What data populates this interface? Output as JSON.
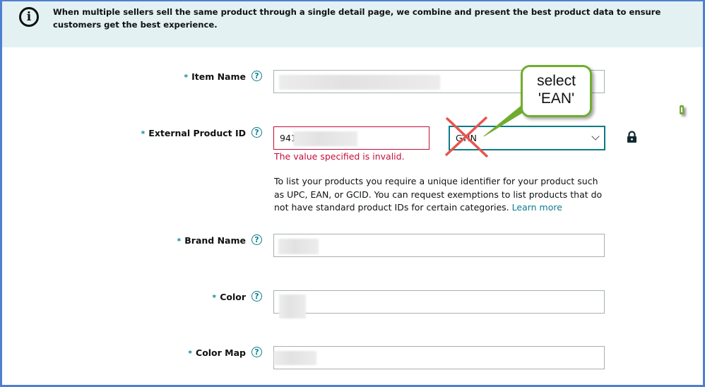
{
  "banner": {
    "icon": "info-icon",
    "text": "When multiple sellers sell the same product through a single detail page, we combine and present the best product data to ensure customers get the best experience."
  },
  "form": {
    "required_marker": "*",
    "help_glyph": "?",
    "fields": [
      {
        "label": "Item Name",
        "value": "",
        "redacted": true
      },
      {
        "label": "External Product ID",
        "value": "941",
        "redacted": true,
        "error": "The value specified is invalid.",
        "id_type": {
          "selected": "GTIN"
        },
        "help_text": "To list your products you require a unique identifier for your product such as UPC, EAN, or GCID. You can request exemptions to list products that do not have standard product IDs for certain categories.",
        "learn_more": "Learn more"
      },
      {
        "label": "Brand Name",
        "value": "",
        "redacted": true
      },
      {
        "label": "Color",
        "value": "",
        "redacted": true
      },
      {
        "label": "Color Map",
        "value": "",
        "redacted": true
      }
    ]
  },
  "annotation": {
    "callout_text": "select 'EAN'",
    "callout_line1": "select",
    "callout_line2": "'EAN'",
    "strike_color": "#e8544f",
    "callout_color": "#6fad2e"
  },
  "colors": {
    "accent": "#0a7d8c",
    "error": "#c40d3c",
    "banner_bg": "#e3f1f3",
    "frame": "#4f7fcf"
  }
}
